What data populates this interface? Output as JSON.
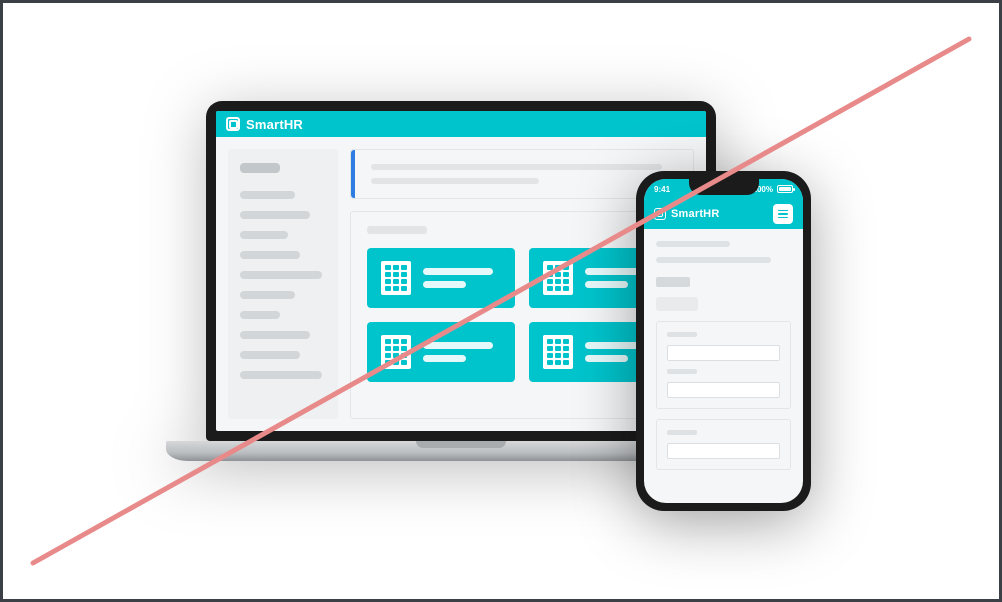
{
  "brand": "SmartHR",
  "statusbar": {
    "time": "9:41",
    "battery": "100%"
  },
  "icons": {
    "logo": "logo-icon",
    "menu": "hamburger-icon",
    "building": "building-icon",
    "signal": "signal-icon",
    "wifi": "wifi-icon",
    "battery": "battery-icon"
  },
  "colors": {
    "accent": "#00c4cc",
    "strike": "#e88a8a",
    "info_accent": "#2f7de1"
  }
}
